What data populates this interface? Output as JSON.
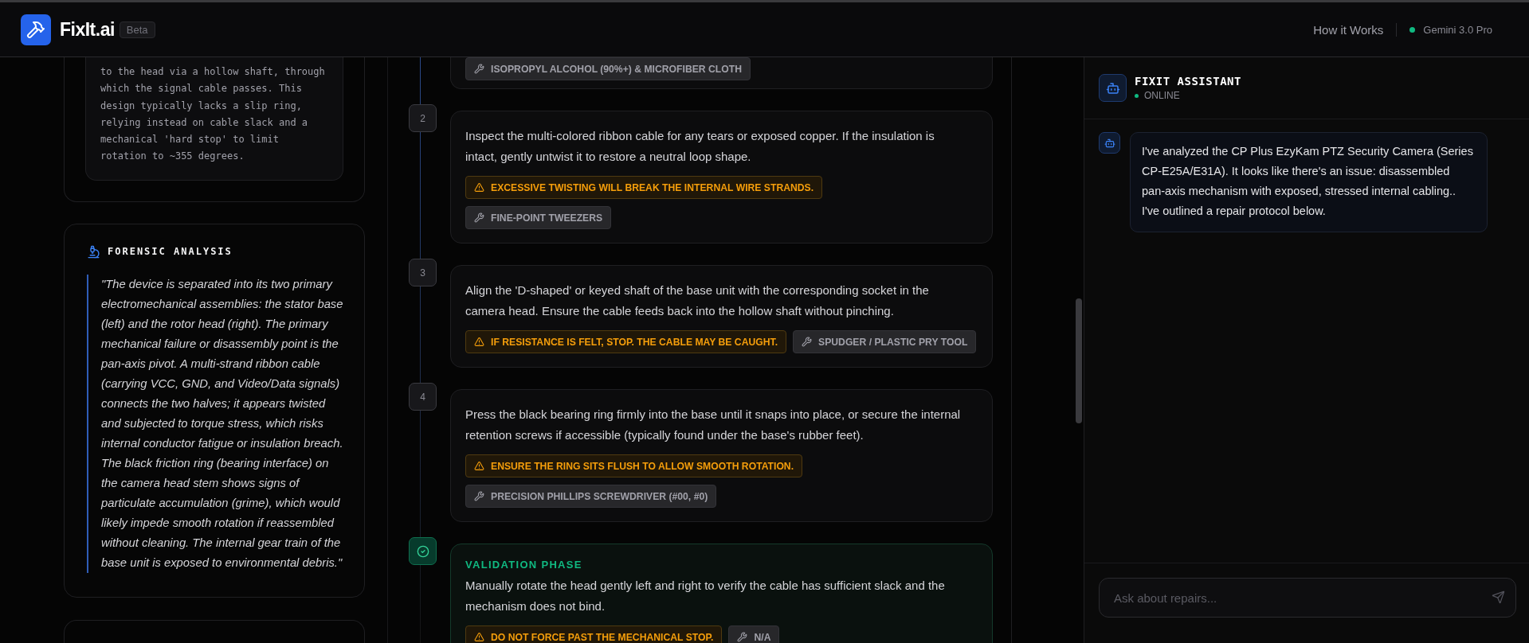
{
  "header": {
    "brand": "FixIt.ai",
    "badge": "Beta",
    "nav_link": "How it Works",
    "model": "Gemini 3.0 Pro"
  },
  "left_panel": {
    "spec_text": "to the head via a hollow shaft, through which the signal cable passes. This design typically lacks a slip ring, relying instead on cable slack and a mechanical 'hard stop' to limit rotation to ~355 degrees.",
    "forensic": {
      "title": "FORENSIC ANALYSIS",
      "quote": "\"The device is separated into its two primary electromechanical assemblies: the stator base (left) and the rotor head (right). The primary mechanical failure or disassembly point is the pan-axis pivot. A multi-strand ribbon cable (carrying VCC, GND, and Video/Data signals) connects the two halves; it appears twisted and subjected to torque stress, which risks internal conductor fatigue or insulation breach. The black friction ring (bearing interface) on the camera head stem shows signs of particulate accumulation (grime), which would likely impede smooth rotation if reassembled without cleaning. The internal gear train of the base unit is exposed to environmental debris.\""
    }
  },
  "steps": [
    {
      "kind": "partial",
      "tools": [
        "ISOPROPYL ALCOHOL (90%+) & MICROFIBER CLOTH"
      ]
    },
    {
      "kind": "step",
      "number": "2",
      "text": "Inspect the multi-colored ribbon cable for any tears or exposed copper. If the insulation is intact, gently untwist it to restore a neutral loop shape.",
      "warning": "EXCESSIVE TWISTING WILL BREAK THE INTERNAL WIRE STRANDS.",
      "tools_on_new_line": true,
      "tools": [
        "FINE-POINT TWEEZERS"
      ]
    },
    {
      "kind": "step",
      "number": "3",
      "text": "Align the 'D-shaped' or keyed shaft of the base unit with the corresponding socket in the camera head. Ensure the cable feeds back into the hollow shaft without pinching.",
      "warning": "IF RESISTANCE IS FELT, STOP. THE CABLE MAY BE CAUGHT.",
      "tools_on_new_line": false,
      "tools": [
        "SPUDGER / PLASTIC PRY TOOL"
      ]
    },
    {
      "kind": "step",
      "number": "4",
      "text": "Press the black bearing ring firmly into the base until it snaps into place, or secure the internal retention screws if accessible (typically found under the base's rubber feet).",
      "warning": "ENSURE THE RING SITS FLUSH TO ALLOW SMOOTH ROTATION.",
      "tools_on_new_line": true,
      "tools": [
        "PRECISION PHILLIPS SCREWDRIVER (#00, #0)"
      ]
    },
    {
      "kind": "validation",
      "title": "VALIDATION PHASE",
      "text": "Manually rotate the head gently left and right to verify the cable has sufficient slack and the mechanism does not bind.",
      "warning": "DO NOT FORCE PAST THE MECHANICAL STOP.",
      "tools_on_new_line": false,
      "tools": [
        "N/A"
      ]
    }
  ],
  "assistant": {
    "title": "FIXIT ASSISTANT",
    "status": "ONLINE",
    "messages": [
      "I've analyzed the CP Plus EzyKam PTZ Security Camera (Series CP-E25A/E31A). It looks like there's an issue: disassembled pan-axis mechanism with exposed, stressed internal cabling.. I've outlined a repair protocol below."
    ],
    "input": {
      "placeholder": "Ask about repairs..."
    }
  }
}
